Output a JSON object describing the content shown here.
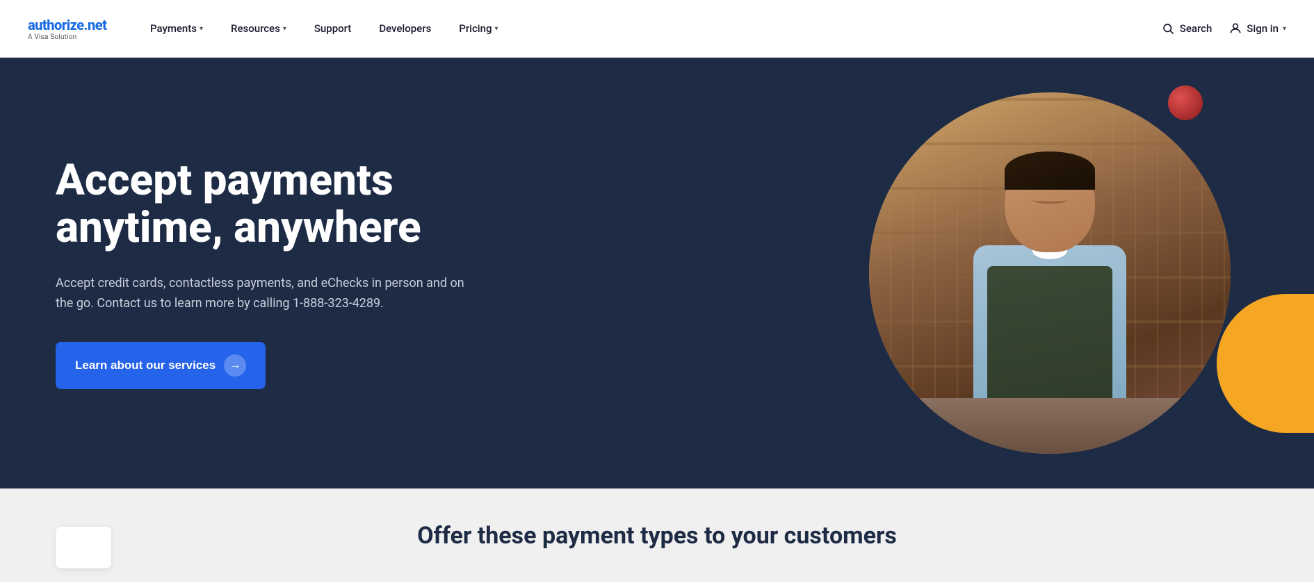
{
  "brand": {
    "name_part1": "authorize",
    "name_dot": ".",
    "name_part2": "net",
    "tagline": "A Visa Solution"
  },
  "navbar": {
    "payments_label": "Payments",
    "resources_label": "Resources",
    "support_label": "Support",
    "developers_label": "Developers",
    "pricing_label": "Pricing",
    "search_label": "Search",
    "signin_label": "Sign in"
  },
  "hero": {
    "title": "Accept payments anytime, anywhere",
    "description": "Accept credit cards, contactless payments, and eChecks in person and on the go. Contact us to learn more by calling 1-888-323-4289.",
    "cta_label": "Learn about our services"
  },
  "bottom": {
    "title": "Offer these payment types to your customers"
  }
}
